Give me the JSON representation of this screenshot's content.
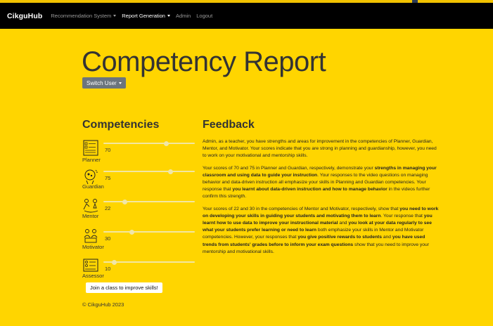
{
  "nav": {
    "brand": "CikguHub",
    "items": [
      {
        "label": "Recommendation System",
        "dropdown": true,
        "active": false
      },
      {
        "label": "Report Generation",
        "dropdown": true,
        "active": true
      },
      {
        "label": "Admin",
        "dropdown": false,
        "active": false
      },
      {
        "label": "Logout",
        "dropdown": false,
        "active": false
      }
    ]
  },
  "page": {
    "title": "Competency Report",
    "switch_user": "Switch User"
  },
  "competencies": {
    "heading": "Competencies",
    "items": [
      {
        "name": "Planner",
        "score": "70",
        "level": 70,
        "icon": "planner-icon"
      },
      {
        "name": "Guardian",
        "score": "75",
        "level": 75,
        "icon": "guardian-icon"
      },
      {
        "name": "Mentor",
        "score": "22",
        "level": 22,
        "icon": "mentor-icon"
      },
      {
        "name": "Motivator",
        "score": "30",
        "level": 30,
        "icon": "motivator-icon"
      },
      {
        "name": "Assessor",
        "score": "10",
        "level": 10,
        "icon": "assessor-icon"
      }
    ],
    "join_button": "Join a class to improve skills!"
  },
  "footer": "© CikguHub 2023",
  "feedback": {
    "heading": "Feedback",
    "paragraphs": [
      [
        {
          "t": "Admin, as a teacher, you have strengths and areas for improvement in the competencies of Planner, Guardian, Mentor, and Motivator. Your scores indicate that you are strong in planning and guardianship, however, you need to work on your motivational and mentorship skills.",
          "b": false
        }
      ],
      [
        {
          "t": "Your scores of 70 and 75 in Planner and Guardian, respectively, demonstrate your ",
          "b": false
        },
        {
          "t": "strengths in managing your classroom and using data to guide your instruction",
          "b": true
        },
        {
          "t": ". Your responses to the video questions on managing behavior and data-driven instruction all emphasize your skills in Planning and Guardian competencies. Your response that ",
          "b": false
        },
        {
          "t": "you learnt about data-driven instruction and how to manage behavior",
          "b": true
        },
        {
          "t": " in the videos further confirm this strength.",
          "b": false
        }
      ],
      [
        {
          "t": "Your scores of 22 and 30 in the competencies of Mentor and Motivator, respectively, show that ",
          "b": false
        },
        {
          "t": "you need to work on developing your skills in guiding your students and motivating them to learn",
          "b": true
        },
        {
          "t": ". Your response that ",
          "b": false
        },
        {
          "t": "you learnt how to use data to improve your instructional material",
          "b": true
        },
        {
          "t": " and ",
          "b": false
        },
        {
          "t": "you look at your data regularly to see what your students prefer learning or need to learn",
          "b": true
        },
        {
          "t": " both emphasize your skills in Mentor and Motivator competencies. However, your responses that ",
          "b": false
        },
        {
          "t": "you give positive rewards to students",
          "b": true
        },
        {
          "t": " and ",
          "b": false
        },
        {
          "t": "you have used trends from students' grades before to inform your exam questions",
          "b": true
        },
        {
          "t": " show that you need to improve your mentorship and motivational skills.",
          "b": false
        }
      ]
    ]
  }
}
